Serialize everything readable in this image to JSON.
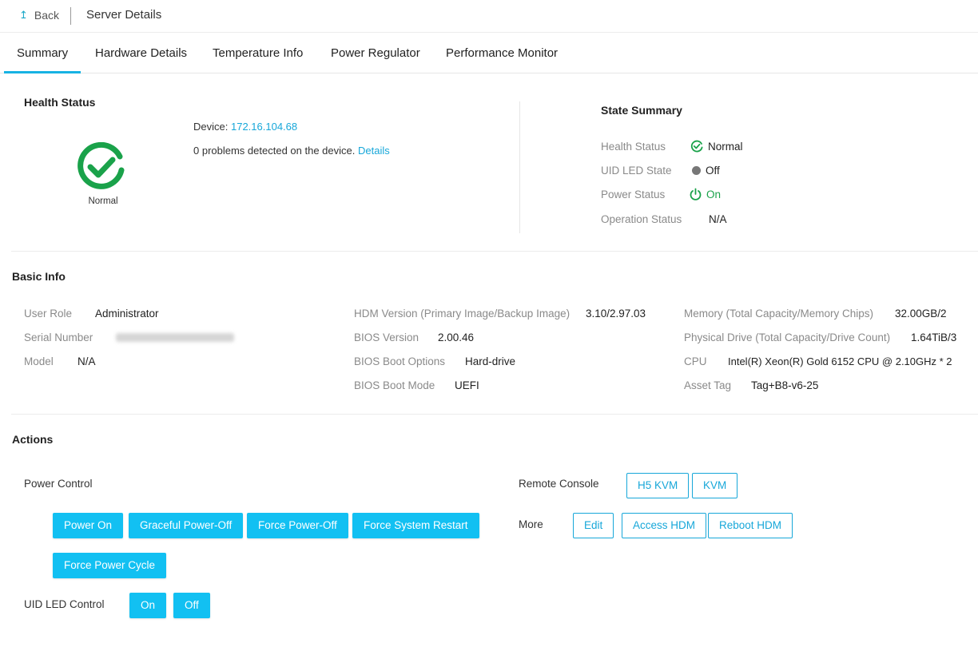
{
  "header": {
    "back_label": "Back",
    "back_icon": "arrow-up-icon",
    "title": "Server Details"
  },
  "tabs": [
    {
      "label": "Summary",
      "active": true
    },
    {
      "label": "Hardware Details",
      "active": false
    },
    {
      "label": "Temperature Info",
      "active": false
    },
    {
      "label": "Power Regulator",
      "active": false
    },
    {
      "label": "Performance Monitor",
      "active": false
    }
  ],
  "health": {
    "title": "Health Status",
    "icon": "check-circle-icon",
    "status_caption": "Normal",
    "device_label": "Device:",
    "device_ip": "172.16.104.68",
    "problems_text": "0 problems detected on the device.",
    "details_link": "Details"
  },
  "state_summary": {
    "title": "State Summary",
    "rows": [
      {
        "label": "Health Status",
        "value": "Normal",
        "icon": "check-circle-icon",
        "color": "#1aa24a"
      },
      {
        "label": "UID LED State",
        "value": "Off",
        "icon": "dot-icon",
        "color": "#777777"
      },
      {
        "label": "Power Status",
        "value": "On",
        "icon": "power-icon",
        "color": "#1aa24a"
      },
      {
        "label": "Operation Status",
        "value": "N/A"
      }
    ]
  },
  "basic_info": {
    "title": "Basic Info",
    "col1": [
      {
        "label": "User Role",
        "value": "Administrator"
      },
      {
        "label": "Serial Number",
        "value": ""
      },
      {
        "label": "Model",
        "value": "N/A"
      }
    ],
    "col2": [
      {
        "label": "HDM Version (Primary Image/Backup Image)",
        "value": "3.10/2.97.03"
      },
      {
        "label": "BIOS Version",
        "value": "2.00.46"
      },
      {
        "label": "BIOS Boot Options",
        "value": "Hard-drive"
      },
      {
        "label": "BIOS Boot Mode",
        "value": "UEFI"
      }
    ],
    "col3": [
      {
        "label": "Memory (Total Capacity/Memory Chips)",
        "value": "32.00GB/2"
      },
      {
        "label": "Physical Drive (Total Capacity/Drive Count)",
        "value": "1.64TiB/3"
      },
      {
        "label": "CPU",
        "value": "Intel(R) Xeon(R) Gold 6152 CPU @ 2.10GHz * 2"
      },
      {
        "label": "Asset Tag",
        "value": "Tag+B8-v6-25"
      }
    ]
  },
  "actions": {
    "title": "Actions",
    "power_control_label": "Power Control",
    "power_buttons": [
      "Power On",
      "Graceful Power-Off",
      "Force Power-Off",
      "Force System Restart",
      "Force Power Cycle"
    ],
    "uid_label": "UID LED Control",
    "uid_buttons": [
      "On",
      "Off"
    ],
    "remote_console_label": "Remote Console",
    "remote_buttons": [
      "H5 KVM",
      "KVM"
    ],
    "more_label": "More",
    "more_buttons": [
      "Edit",
      "Access HDM",
      "Reboot HDM"
    ]
  },
  "colors": {
    "accent": "#12c0f2",
    "link": "#17a7d9",
    "ok": "#1aa24a",
    "tab_underline": "#17b2e3"
  }
}
